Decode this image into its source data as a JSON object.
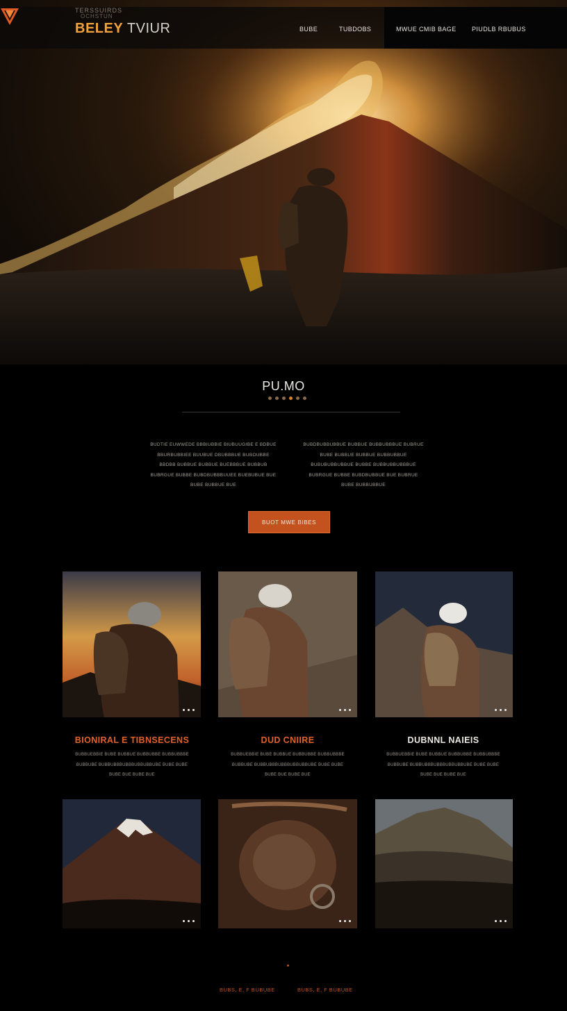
{
  "header": {
    "brand_top": "TERSSUIRDS",
    "brand_sub": "OCHSTUN",
    "brand_primary": "BELEY",
    "brand_secondary": "TVIUR",
    "nav": [
      "BUBE",
      "TUBDOBS",
      "MWUE CMIB BAGE",
      "PIUDLB RBUBUS"
    ]
  },
  "intro": {
    "title": "PU.MO",
    "left_lines": [
      "BUDTIE EUWWEDE BBBIUBBIE BIUBUUGIBE E BDBUE",
      "BBURBUBBIEE BUUBUE DBUBBBUE BUBOUBBE",
      "BBDBB BUBBUE BUBBUE BUEBBBUE BUBBUB",
      "BUBRGUE BUBBE BUBDBUBBBUUEE BUEBUBUE BUE",
      "BUBE BUBBUE BUE"
    ],
    "right_lines": [
      "BUBDBUBBUBBUE BUBBUE BUBBUBBBUE BUBRUE",
      "BUBE BUBBUE BUBBUE BUBBUBBUE",
      "BUBUBUBBUBBUE BUBBE BUBBUBBUBBBUE",
      "BUBRGUE BUBBE BUBDBUBBUE BUE BUBRUE",
      "BUBE BUBBUBBUE"
    ],
    "cta": "BUOT MWE BIBES"
  },
  "cards": [
    {
      "title": "BIONIRAL E TIBNSECENS",
      "title_color": "#e0622a",
      "lines": [
        "BUBBUEBBIE BUBE BUBBUE BUBBUBBE BUBBUBBBE",
        "BUBBUBE BUBBUBBBUBBBUBBUBBUBE BUBE BUBE",
        "BUBE BUE BUBE BUE"
      ]
    },
    {
      "title": "DUD CNIIRE",
      "title_color": "#e0622a",
      "lines": [
        "BUBBUEBBIE BUBE BUBBUE BUBBUBBE BUBBUBBBE",
        "BUBBUBE BUBBUBBBUBBBUBBUBBUBE BUBE BUBE",
        "BUBE BUE BUBE BUE"
      ]
    },
    {
      "title": "DUBNNL NAIEIS",
      "title_color": "#ece8e2",
      "lines": [
        "BUBBUEBBIE BUBE BUBBUE BUBBUBBE BUBBUBBBE",
        "BUBBUBE BUBBUBBBUBBBUBBUBBUBE BUBE BUBE",
        "BUBE BUE BUBE BUE"
      ]
    }
  ],
  "footer": {
    "links": [
      "BUBS, E, F BUBUBE",
      "BUBS, E, F BUBUBE"
    ]
  },
  "colors": {
    "accent": "#c4521e",
    "brand": "#f2a23c",
    "bg": "#000000"
  }
}
